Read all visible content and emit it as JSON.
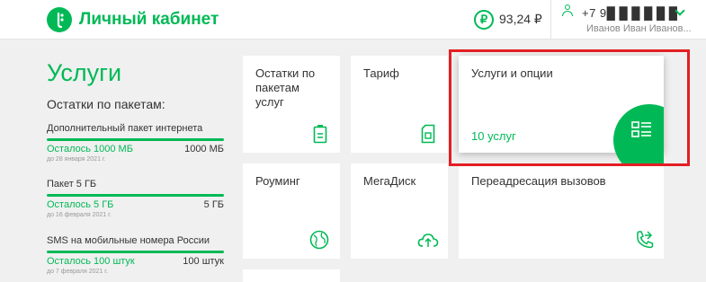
{
  "header": {
    "brand": "Личный кабинет",
    "balance": "93,24 ₽",
    "balance_icon_glyph": "₽",
    "phone": "+7 9█ █ █ █ █ █",
    "user_name": "Иванов Иван Иванов..."
  },
  "page": {
    "title": "Услуги",
    "packages_heading": "Остатки по пакетам:"
  },
  "packages": [
    {
      "name": "Дополнительный пакет интернета",
      "remaining": "Осталось 1000 МБ",
      "total": "1000 МБ",
      "date": "до 28 января 2021 г."
    },
    {
      "name": "Пакет 5 ГБ",
      "remaining": "Осталось 5 ГБ",
      "total": "5 ГБ",
      "date": "до 16 февраля 2021 г."
    },
    {
      "name": "SMS на мобильные номера России",
      "remaining": "Осталось 100 штук",
      "total": "100 штук",
      "date": "до 7 февраля 2021 г."
    }
  ],
  "tiles": {
    "balances": {
      "title": "Остатки по пакетам услуг",
      "icon": "battery-icon"
    },
    "tariff": {
      "title": "Тариф",
      "icon": "sim-card-icon"
    },
    "services": {
      "title": "Услуги и опции",
      "count": "10 услуг",
      "icon": "list-icon"
    },
    "roaming": {
      "title": "Роуминг",
      "icon": "globe-icon"
    },
    "megadisk": {
      "title": "МегаДиск",
      "icon": "cloud-icon"
    },
    "forwarding": {
      "title": "Переадресация вызовов",
      "icon": "call-forward-icon"
    }
  },
  "colors": {
    "accent": "#00b956",
    "highlight": "#e31e24",
    "background": "#f0f0f0"
  }
}
